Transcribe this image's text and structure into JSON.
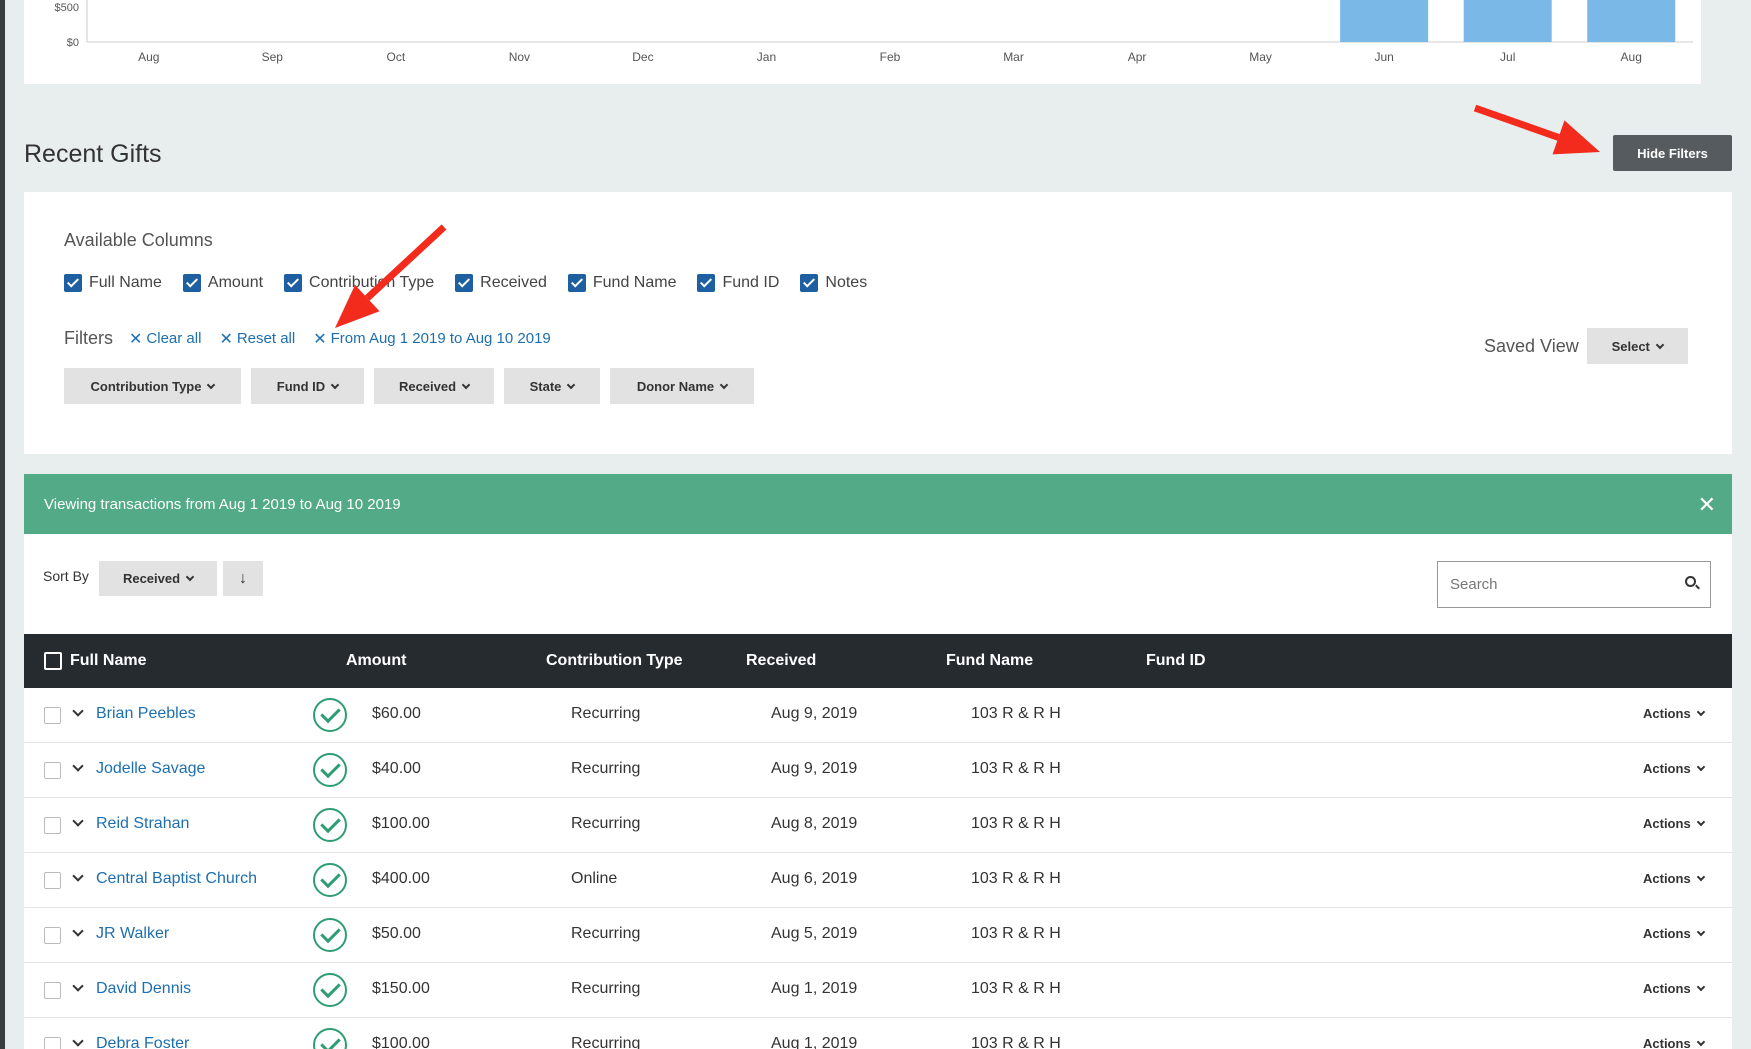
{
  "chart": {
    "y_ticks": [
      "$500",
      "$0"
    ],
    "months": [
      "Aug",
      "Sep",
      "Oct",
      "Nov",
      "Dec",
      "Jan",
      "Feb",
      "Mar",
      "Apr",
      "May",
      "Jun",
      "Jul",
      "Aug"
    ],
    "bar_color": "#7ab8e8"
  },
  "header": {
    "title": "Recent Gifts",
    "hide_filters_label": "Hide Filters"
  },
  "columns": {
    "title": "Available Columns",
    "items": [
      "Full Name",
      "Amount",
      "Contribution Type",
      "Received",
      "Fund Name",
      "Fund ID",
      "Notes"
    ]
  },
  "filters": {
    "label": "Filters",
    "chips": [
      "Clear all",
      "Reset all",
      "From Aug 1 2019 to Aug 10 2019"
    ],
    "dropdowns": [
      "Contribution Type",
      "Fund ID",
      "Received",
      "State",
      "Donor Name"
    ],
    "saved_view_label": "Saved View",
    "select_label": "Select"
  },
  "banner": {
    "text": "Viewing transactions from Aug 1 2019 to Aug 10 2019",
    "close": "✕"
  },
  "toolbar": {
    "sort_label": "Sort By",
    "sort_value": "Received",
    "direction_icon": "↓",
    "search_placeholder": "Search"
  },
  "table": {
    "headers": [
      "Full Name",
      "Amount",
      "Contribution Type",
      "Received",
      "Fund Name",
      "Fund ID"
    ],
    "actions_label": "Actions",
    "rows": [
      {
        "name": "Brian Peebles",
        "amount": "$60.00",
        "type": "Recurring",
        "received": "Aug 9, 2019",
        "fund": "103 R & R H"
      },
      {
        "name": "Jodelle Savage",
        "amount": "$40.00",
        "type": "Recurring",
        "received": "Aug 9, 2019",
        "fund": "103 R & R H"
      },
      {
        "name": "Reid Strahan",
        "amount": "$100.00",
        "type": "Recurring",
        "received": "Aug 8, 2019",
        "fund": "103 R & R H"
      },
      {
        "name": "Central Baptist Church",
        "amount": "$400.00",
        "type": "Online",
        "received": "Aug 6, 2019",
        "fund": "103 R & R H"
      },
      {
        "name": "JR Walker",
        "amount": "$50.00",
        "type": "Recurring",
        "received": "Aug 5, 2019",
        "fund": "103 R & R H"
      },
      {
        "name": "David Dennis",
        "amount": "$150.00",
        "type": "Recurring",
        "received": "Aug 1, 2019",
        "fund": "103 R & R H"
      },
      {
        "name": "Debra Foster",
        "amount": "$100.00",
        "type": "Recurring",
        "received": "Aug 1, 2019",
        "fund": "103 R & R H"
      }
    ]
  },
  "annotations": {
    "arrow_color": "#f22b1c"
  }
}
